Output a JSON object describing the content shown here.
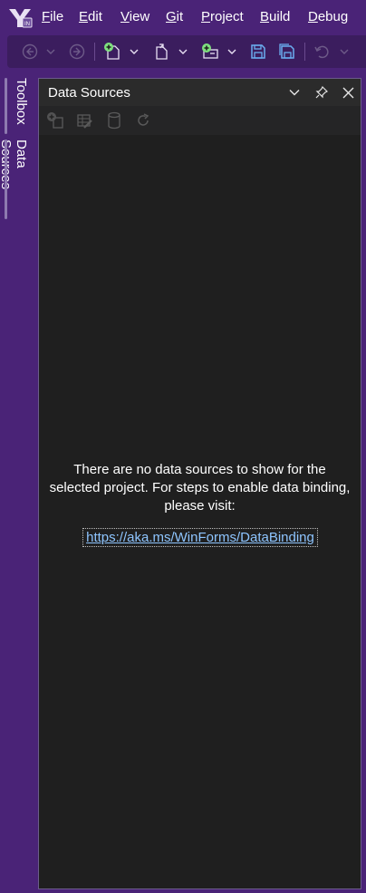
{
  "menubar": {
    "items": [
      {
        "label": "File",
        "mnemonic": "F",
        "rest": "ile"
      },
      {
        "label": "Edit",
        "mnemonic": "E",
        "rest": "dit"
      },
      {
        "label": "View",
        "mnemonic": "V",
        "rest": "iew"
      },
      {
        "label": "Git",
        "mnemonic": "G",
        "rest": "it"
      },
      {
        "label": "Project",
        "mnemonic": "P",
        "rest": "roject"
      },
      {
        "label": "Build",
        "mnemonic": "B",
        "rest": "uild"
      },
      {
        "label": "Debug",
        "mnemonic": "D",
        "rest": "ebug"
      }
    ]
  },
  "toolbar": {
    "icons": [
      "navigate-back-icon",
      "chevron-down-icon",
      "navigate-forward-icon",
      "new-project-icon",
      "chevron-down-icon",
      "open-file-icon",
      "chevron-down-icon",
      "add-item-icon",
      "chevron-down-icon",
      "save-icon",
      "save-all-icon",
      "undo-icon",
      "chevron-down-icon"
    ]
  },
  "sidetabs": {
    "toolbox": "Toolbox",
    "data_sources": "Data Sources"
  },
  "panel": {
    "title": "Data Sources",
    "message": "There are no data sources to show for the selected project. For steps to enable data binding, please visit:",
    "link": "https://aka.ms/WinForms/DataBinding",
    "toolbar_icons": [
      "add-data-source-icon",
      "edit-dataset-icon",
      "configure-database-icon",
      "refresh-icon"
    ]
  },
  "colors": {
    "chrome": "#4a2377",
    "panel_bg": "#1f1f1f",
    "link": "#8ec5ff",
    "accent_green": "#7ee07e"
  }
}
